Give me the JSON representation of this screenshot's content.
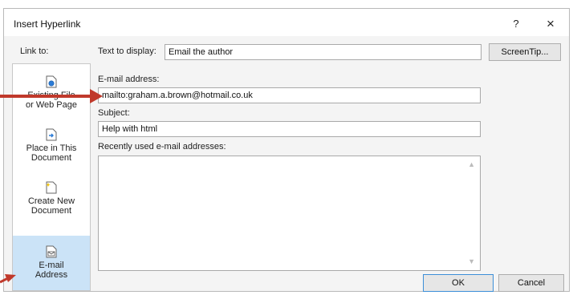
{
  "dialog": {
    "title": "Insert Hyperlink",
    "help_label": "?",
    "close_label": "×"
  },
  "sidebar": {
    "heading": "Link to:",
    "items": [
      {
        "label_line1": "Existing File",
        "label_line2": "or Web Page",
        "icon": "globe-page-icon"
      },
      {
        "label_line1": "Place in This",
        "label_line2": "Document",
        "icon": "document-arrow-icon"
      },
      {
        "label_line1": "Create New",
        "label_line2": "Document",
        "icon": "new-document-icon"
      },
      {
        "label_line1": "E-mail",
        "label_line2": "Address",
        "icon": "email-icon"
      }
    ]
  },
  "form": {
    "text_to_display_label": "Text to display:",
    "text_to_display_value": "Email the author",
    "screentip_label": "ScreenTip...",
    "email_label": "E-mail address:",
    "email_value": "mailto:graham.a.brown@hotmail.co.uk",
    "subject_label": "Subject:",
    "subject_value": "Help with html",
    "recent_label": "Recently used e-mail addresses:"
  },
  "buttons": {
    "ok": "OK",
    "cancel": "Cancel"
  },
  "colors": {
    "arrow": "#c0392b",
    "selected_item": "#cbe3f7",
    "default_button_border": "#3c8fd8"
  }
}
